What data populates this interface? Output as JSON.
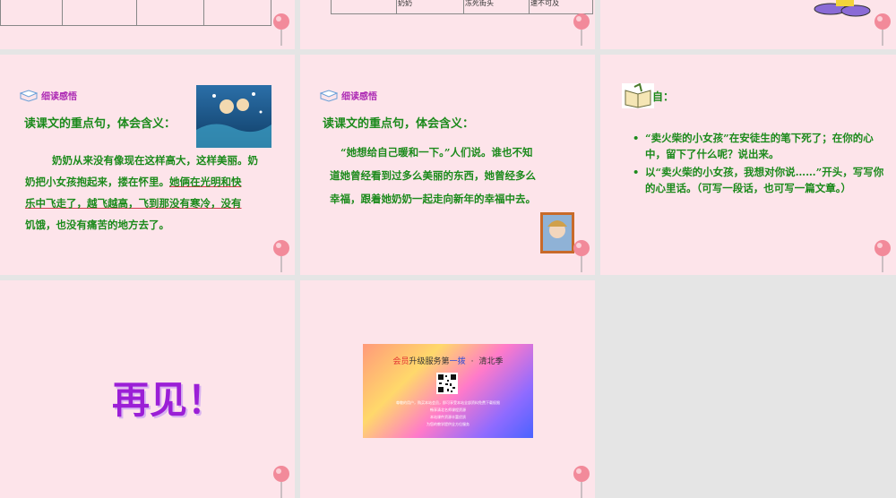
{
  "slides": {
    "s2": {
      "cells": [
        "奶奶",
        "冻死街头",
        "速不可及"
      ]
    },
    "s4": {
      "header_label": "细读感悟",
      "subtitle": "读课文的重点句，体会含义：",
      "para": [
        "奶奶从来没有像现在这样高大，这样美丽。奶",
        "奶把小女孩抱起来，搂在怀里。",
        "她俩在光明和快",
        "乐中飞走了，越飞越高，飞到那没有寒冷，没有",
        "饥饿，也没有痛苦的地方去了。"
      ]
    },
    "s5": {
      "header_label": "细读感悟",
      "subtitle": "读课文的重点句，体会含义：",
      "para": [
        "“她想给自己暖和一下。”人们说。谁也不知",
        "道她曾经看到过多么美丽的东西，她曾经多么",
        "幸福，跟着她奶奶一起走向新年的幸福中去。"
      ]
    },
    "s6": {
      "header_tail": "自：",
      "bullets": [
        "“卖火柴的小女孩”在安徒生的笔下死了；在你的心中，留下了什么呢？说出来。",
        "以“卖火柴的小女孩，我想对你说……”开头，写写你的心里话。（可写一段话，也可写一篇文章。）"
      ]
    },
    "s7": {
      "title": "再见！"
    },
    "s8": {
      "ad_title_red": "会员",
      "ad_title_mid": "升级服务第",
      "ad_title_blue": "一拨",
      "ad_title_sep": "·",
      "ad_title_end": "清北季",
      "ad_lines": [
        "尊敬的用户，购买本站会员，即可享受本站全部资料免费下载权限",
        "畅享清北名师课程资源",
        "本站课件资源丰富优质",
        "为您的教学提供全方位服务"
      ]
    }
  },
  "colors": {
    "slide_bg": "#fde4ea",
    "green_text": "#1b8a1b",
    "purple_title": "#9b1fd6",
    "header_purple": "#ad2bb4"
  }
}
